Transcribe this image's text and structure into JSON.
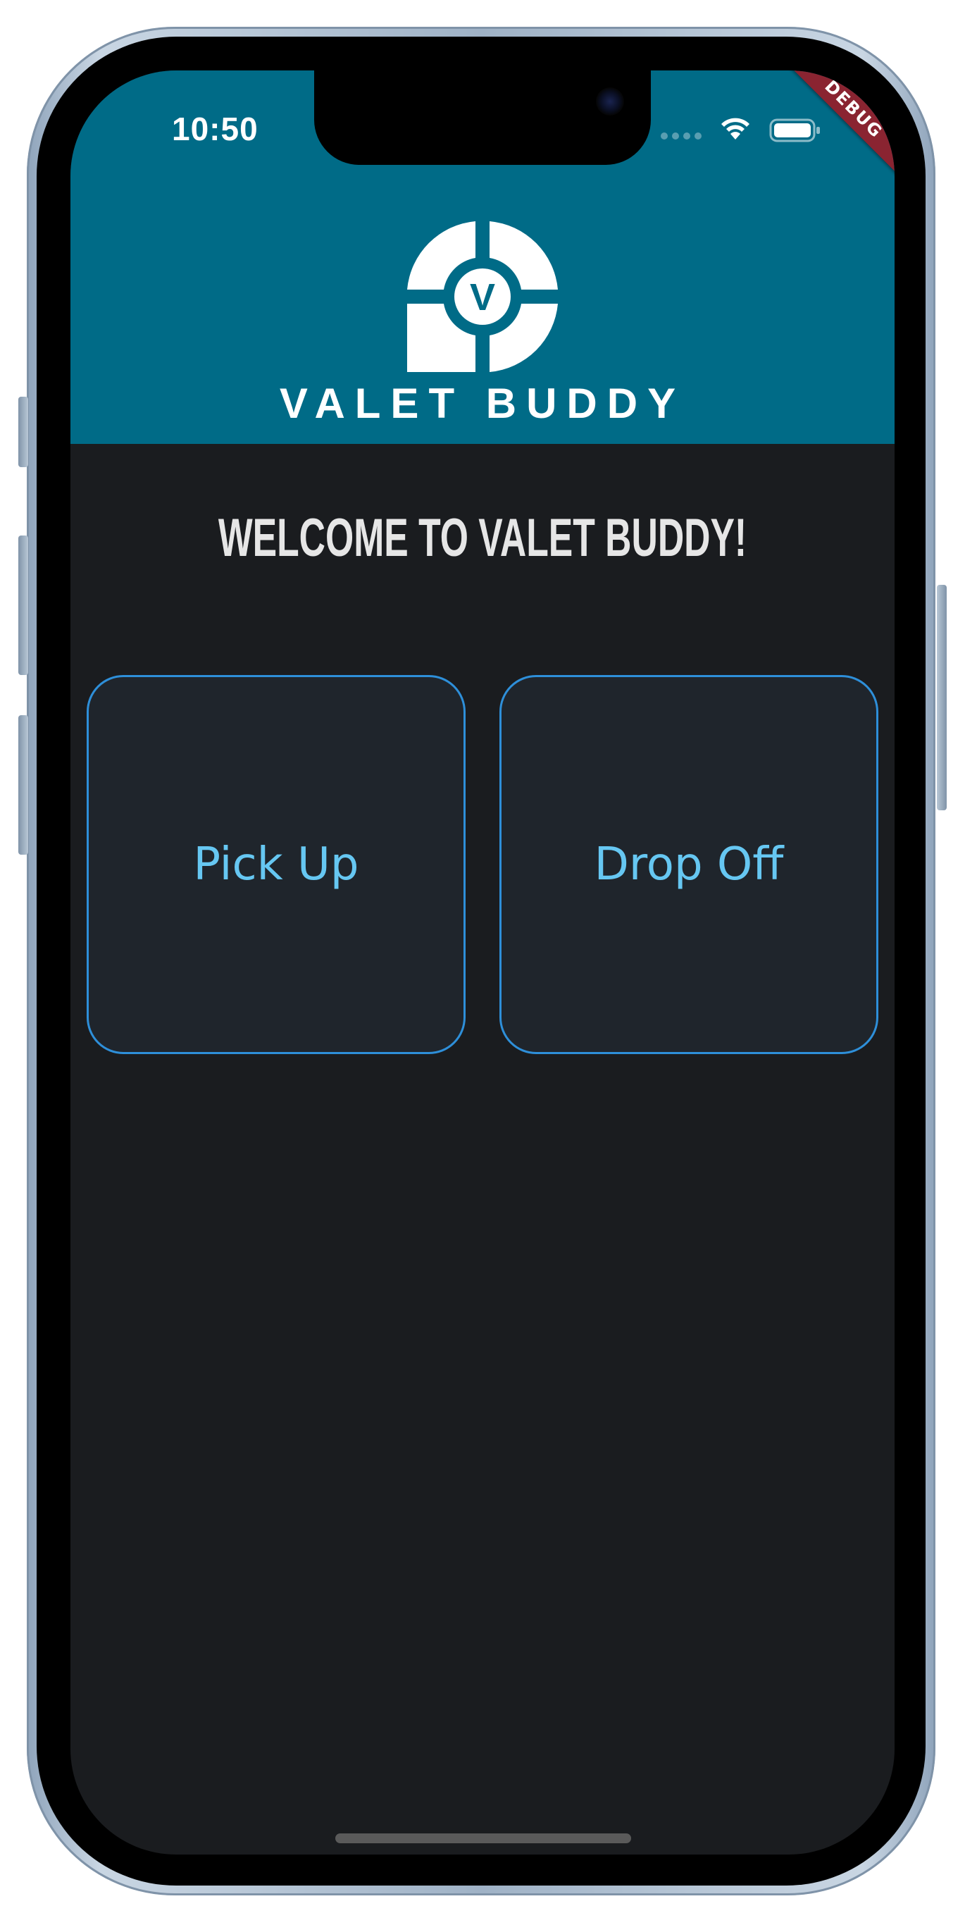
{
  "status_bar": {
    "time": "10:50",
    "icons": [
      "signal-icon",
      "wifi-icon",
      "battery-icon"
    ]
  },
  "debug_banner": "DEBUG",
  "header": {
    "logo_letter": "V",
    "brand_name": "VALET BUDDY",
    "background_color": "#006b87"
  },
  "main": {
    "welcome_text": "WELCOME TO VALET BUDDY!",
    "buttons": [
      {
        "label": "Pick Up"
      },
      {
        "label": "Drop Off"
      }
    ],
    "accent_color": "#2e8fd9",
    "button_text_color": "#66c7f2"
  }
}
